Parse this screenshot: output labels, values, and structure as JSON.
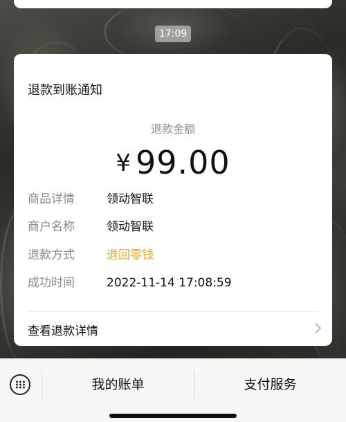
{
  "chat": {
    "timestamp": "17:09"
  },
  "notification": {
    "title": "退款到账通知",
    "amount_label": "退款金额",
    "currency_symbol": "¥",
    "amount": "99.00",
    "fields": [
      {
        "key": "商品详情",
        "value": "领动智联"
      },
      {
        "key": "商户名称",
        "value": "领动智联"
      },
      {
        "key": "退款方式",
        "value": "退回零钱"
      },
      {
        "key": "成功时间",
        "value": "2022-11-14 17:08:59"
      }
    ],
    "details_link": "查看退款详情"
  },
  "bottom_menu": {
    "items": [
      {
        "label": "我的账单"
      },
      {
        "label": "支付服务"
      }
    ]
  },
  "colors": {
    "accent_refund_method": "#f5a623",
    "muted_text": "#8a8a8a",
    "primary_text": "#111111"
  }
}
